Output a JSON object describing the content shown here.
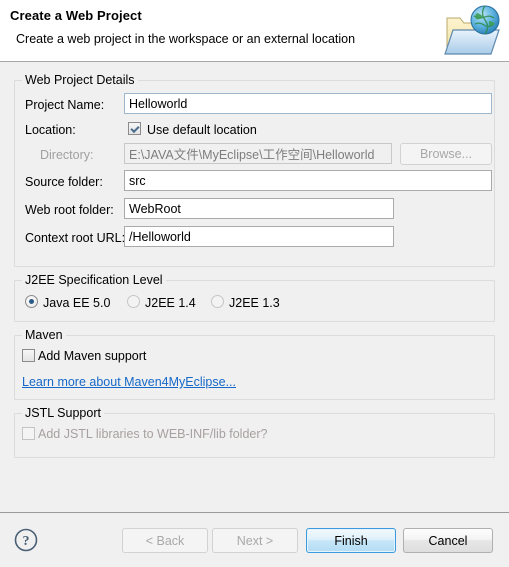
{
  "header": {
    "title": "Create a Web Project",
    "subtitle": "Create a web project in the workspace or an external location",
    "icon": "folder-globe-icon"
  },
  "details": {
    "group_title": "Web Project Details",
    "project_name_label": "Project Name:",
    "project_name_value": "Helloworld",
    "location_label": "Location:",
    "use_default_location_label": "Use default location",
    "use_default_location_checked": true,
    "directory_label": "Directory:",
    "directory_value": "E:\\JAVA文件\\MyEclipse\\工作空间\\Helloworld",
    "browse_label": "Browse...",
    "source_folder_label": "Source folder:",
    "source_folder_value": "src",
    "web_root_label": "Web root folder:",
    "web_root_value": "WebRoot",
    "context_root_label": "Context root URL:",
    "context_root_value": "/Helloworld"
  },
  "j2ee": {
    "group_title": "J2EE Specification Level",
    "options": [
      {
        "label": "Java EE 5.0",
        "selected": true
      },
      {
        "label": "J2EE 1.4",
        "selected": false
      },
      {
        "label": "J2EE 1.3",
        "selected": false
      }
    ]
  },
  "maven": {
    "group_title": "Maven",
    "add_support_label": "Add Maven support",
    "add_support_checked": false,
    "link_label": "Learn more about Maven4MyEclipse..."
  },
  "jstl": {
    "group_title": "JSTL Support",
    "add_libraries_label": "Add JSTL libraries to WEB-INF/lib folder?",
    "add_libraries_checked": false,
    "disabled": true
  },
  "footer": {
    "help_icon": "help-question-icon",
    "back_label": "< Back",
    "next_label": "Next >",
    "finish_label": "Finish",
    "cancel_label": "Cancel"
  },
  "colors": {
    "dialog_bg": "#f0f0f0",
    "header_bg": "#ffffff",
    "link": "#1669c8",
    "default_button_border": "#3c9ade",
    "input_border": "#b4c3d2",
    "disabled_text": "#a0a0a0"
  }
}
